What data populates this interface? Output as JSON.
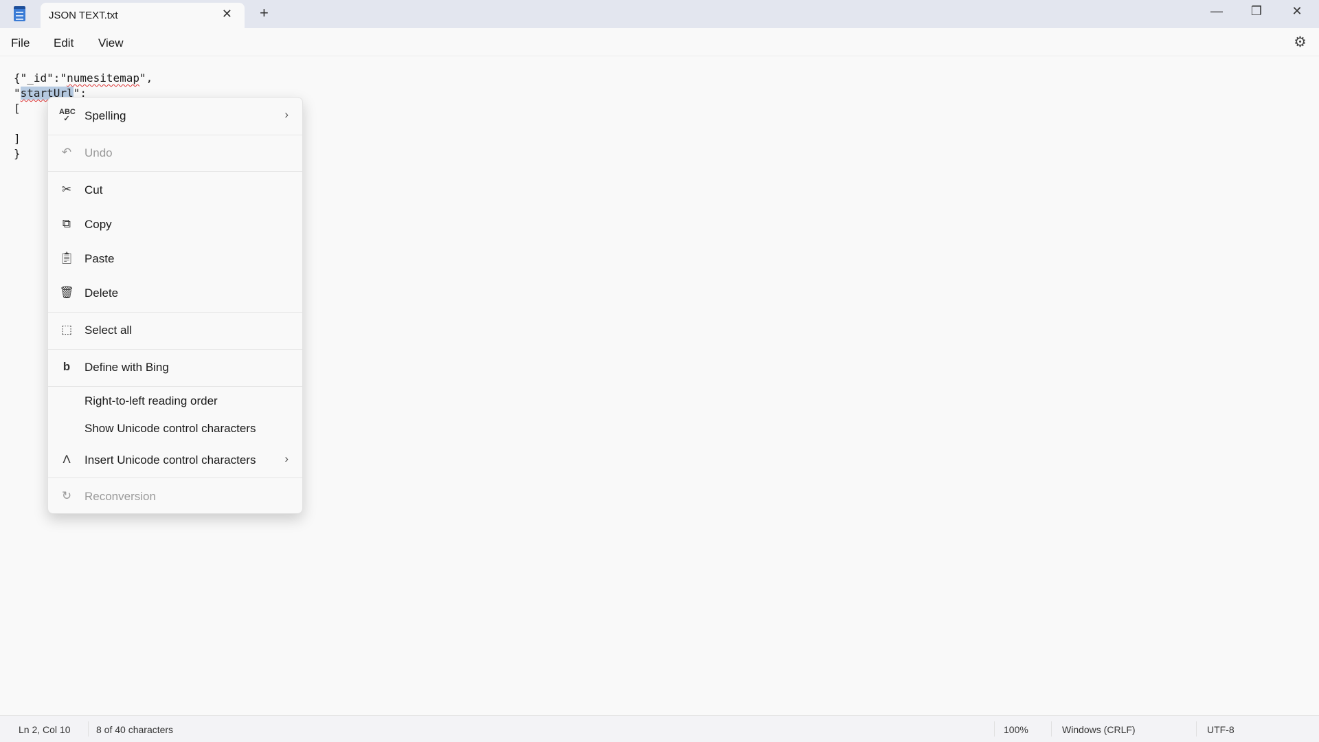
{
  "window": {
    "tab_title": "JSON TEXT.txt",
    "icons": {
      "app": "notepad-icon",
      "close_tab": "close-icon",
      "new_tab": "plus-icon",
      "minimize": "minimize-icon",
      "maximize": "restore-icon",
      "close": "close-icon"
    }
  },
  "menubar": {
    "items": [
      "File",
      "Edit",
      "View"
    ],
    "settings_icon": "gear-icon"
  },
  "editor": {
    "line1_a": "{\"_id\":\"",
    "line1_word": "numesitemap",
    "line1_b": "\",",
    "line2_a": "\"",
    "line2_sel": "startUrl",
    "line2_b": "\":",
    "line3": "[",
    "line4": "",
    "line5": "]",
    "line6": "}"
  },
  "context_menu": {
    "items": [
      {
        "label": "Spelling",
        "icon": "spelling-icon",
        "submenu": true
      },
      {
        "label": "Undo",
        "icon": "undo-icon",
        "disabled": true
      },
      {
        "label": "Cut",
        "icon": "scissors-icon"
      },
      {
        "label": "Copy",
        "icon": "copy-icon"
      },
      {
        "label": "Paste",
        "icon": "paste-icon"
      },
      {
        "label": "Delete",
        "icon": "trash-icon"
      },
      {
        "label": "Select all",
        "icon": "select-all-icon"
      },
      {
        "label": "Define with Bing",
        "icon": "bing-icon"
      },
      {
        "label": "Right-to-left reading order"
      },
      {
        "label": "Show Unicode control characters"
      },
      {
        "label": "Insert Unicode control characters",
        "icon": "caret-icon",
        "submenu": true
      },
      {
        "label": "Reconversion",
        "icon": "reconversion-icon",
        "disabled": true
      }
    ]
  },
  "statusbar": {
    "position": "Ln 2, Col 10",
    "selection": "8 of 40 characters",
    "zoom": "100%",
    "line_ending": "Windows (CRLF)",
    "encoding": "UTF-8"
  }
}
